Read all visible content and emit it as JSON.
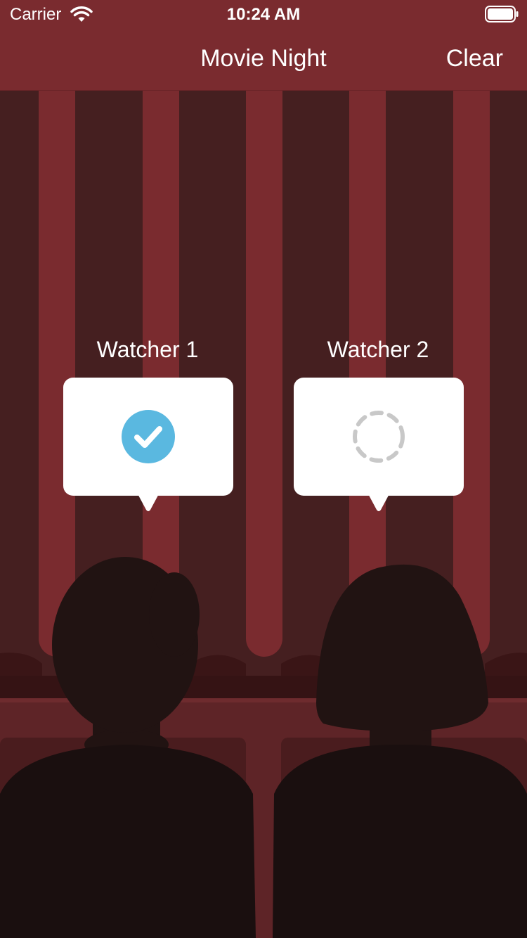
{
  "status_bar": {
    "carrier": "Carrier",
    "time": "10:24 AM",
    "icons": [
      "wifi-icon",
      "battery-icon"
    ]
  },
  "nav_bar": {
    "title": "Movie Night",
    "clear_label": "Clear"
  },
  "watchers": [
    {
      "label": "Watcher 1",
      "status": "ready",
      "status_icon": "checkmark-circle-icon"
    },
    {
      "label": "Watcher 2",
      "status": "waiting",
      "status_icon": "dashed-circle-loading-icon"
    }
  ],
  "colors": {
    "bar_background": "#7a2b2f",
    "curtain_dark": "#451f20",
    "curtain_light": "#7a2b2f",
    "seat_back": "#5e2427",
    "silhouette": "#211312",
    "check_blue": "#5ab8e0",
    "spinner_gray": "#c8c8c8"
  }
}
